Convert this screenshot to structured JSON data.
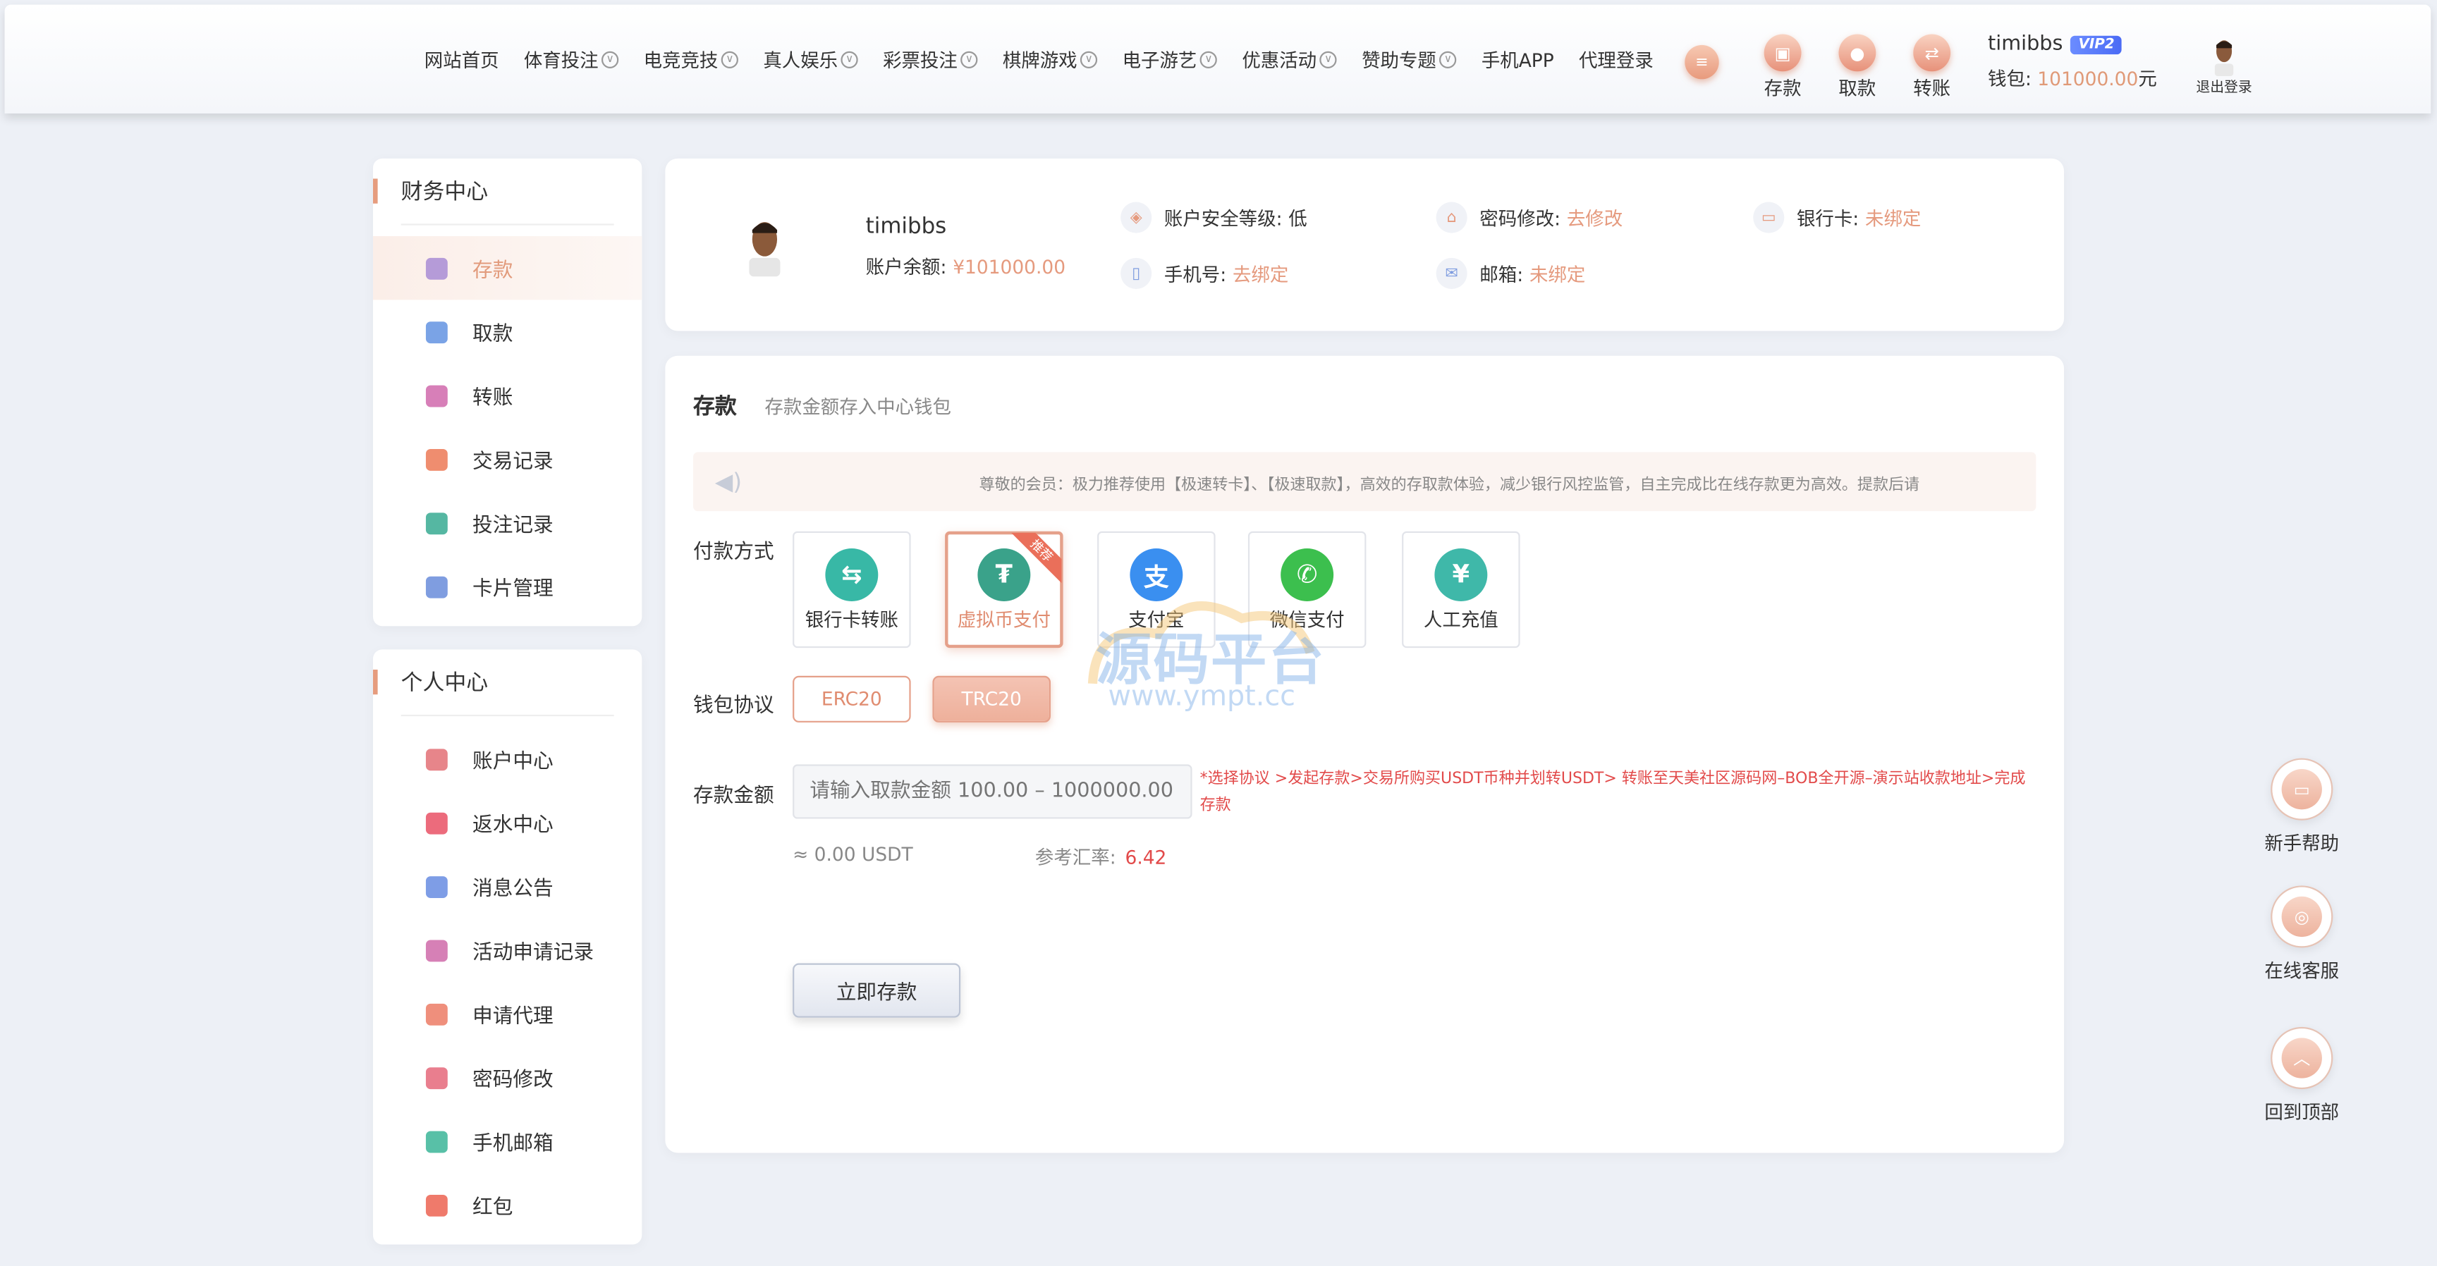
{
  "nav": {
    "items": [
      {
        "label": "网站首页",
        "dropdown": false
      },
      {
        "label": "体育投注",
        "dropdown": true
      },
      {
        "label": "电竞竞技",
        "dropdown": true
      },
      {
        "label": "真人娱乐",
        "dropdown": true
      },
      {
        "label": "彩票投注",
        "dropdown": true
      },
      {
        "label": "棋牌游戏",
        "dropdown": true
      },
      {
        "label": "电子游艺",
        "dropdown": true
      },
      {
        "label": "优惠活动",
        "dropdown": true
      },
      {
        "label": "赞助专题",
        "dropdown": true
      },
      {
        "label": "手机APP",
        "dropdown": false
      },
      {
        "label": "代理登录",
        "dropdown": false
      }
    ],
    "quick": {
      "deposit": "存款",
      "withdraw": "取款",
      "transfer": "转账"
    },
    "user": {
      "name": "timibbs",
      "vip": "VIP2",
      "wallet_label": "钱包:",
      "wallet_amount": "101000.00",
      "wallet_unit": "元"
    },
    "logout": "退出登录"
  },
  "sidebar": {
    "finance_title": "财务中心",
    "finance_items": [
      {
        "label": "存款",
        "color": "#b59bd8"
      },
      {
        "label": "取款",
        "color": "#7aa3e6"
      },
      {
        "label": "转账",
        "color": "#d77fb8"
      },
      {
        "label": "交易记录",
        "color": "#ef8d6f"
      },
      {
        "label": "投注记录",
        "color": "#55b7a2"
      },
      {
        "label": "卡片管理",
        "color": "#7f9de0"
      }
    ],
    "personal_title": "个人中心",
    "personal_items": [
      {
        "label": "账户中心",
        "color": "#e7858a"
      },
      {
        "label": "返水中心",
        "color": "#ec6b7c"
      },
      {
        "label": "消息公告",
        "color": "#7e9de6"
      },
      {
        "label": "活动申请记录",
        "color": "#d680b6"
      },
      {
        "label": "申请代理",
        "color": "#ef8f7c"
      },
      {
        "label": "密码修改",
        "color": "#e97e8e"
      },
      {
        "label": "手机邮箱",
        "color": "#58c0a7"
      },
      {
        "label": "红包",
        "color": "#ef7a6b"
      }
    ]
  },
  "profile": {
    "name": "timibbs",
    "balance_label": "账户余额:",
    "balance": "¥101000.00",
    "security_label": "账户安全等级:",
    "security_value": "低",
    "phone_label": "手机号:",
    "phone_value": "去绑定",
    "password_label": "密码修改:",
    "password_value": "去修改",
    "email_label": "邮箱:",
    "email_value": "未绑定",
    "bank_label": "银行卡:",
    "bank_value": "未绑定"
  },
  "deposit": {
    "title": "存款",
    "subtitle": "存款金额存入中心钱包",
    "notice": "尊敬的会员：极力推荐使用【极速转卡】、【极速取款】，高效的存取款体验，减少银行风控监管，自主完成比在线存款更为高效。提款后请",
    "pay_label": "付款方式",
    "methods": [
      {
        "label": "银行卡转账",
        "color": "#38b8a6",
        "glyph": "⇆"
      },
      {
        "label": "虚拟币支付",
        "color": "#3aa28a",
        "glyph": "₮",
        "badge": "推荐"
      },
      {
        "label": "支付宝",
        "color": "#3a8ff0",
        "glyph": "支"
      },
      {
        "label": "微信支付",
        "color": "#3cbf4e",
        "glyph": "✆"
      },
      {
        "label": "人工充值",
        "color": "#3fb8a9",
        "glyph": "¥"
      }
    ],
    "protocol_label": "钱包协议",
    "protocols": [
      "ERC20",
      "TRC20"
    ],
    "amount_label": "存款金额",
    "amount_placeholder": "请输入取款金额 100.00 – 1000000.00",
    "hint": "选择协议 >发起存款>交易所购买USDT币种并划转USDT> 转账至天美社区源码网–BOB全开源–演示站收款地址>完成存款",
    "usdt": "≈ 0.00 USDT",
    "rate_label": "参考汇率:",
    "rate_value": "6.42",
    "submit": "立即存款"
  },
  "float": {
    "help": "新手帮助",
    "service": "在线客服",
    "top": "回到顶部"
  },
  "watermark": {
    "main": "源码平台",
    "url": "www.ympt.cc"
  }
}
